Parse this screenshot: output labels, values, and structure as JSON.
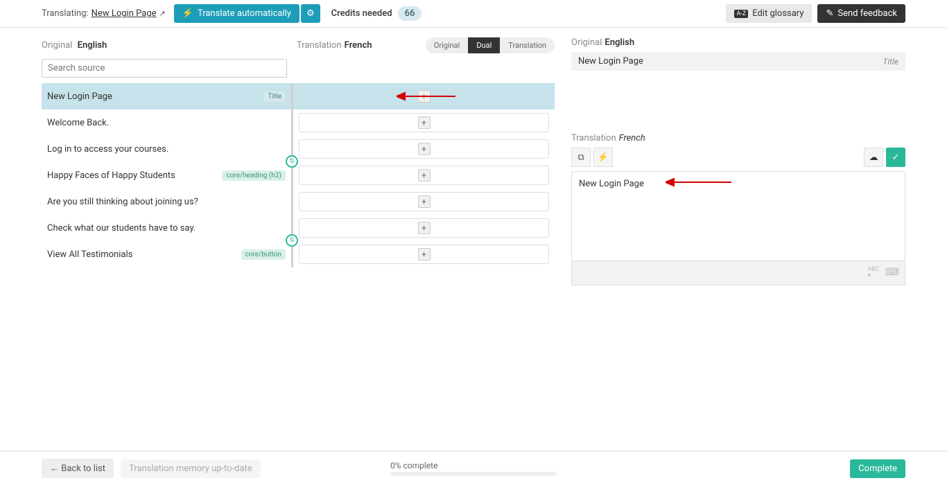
{
  "topbar": {
    "translating_label": "Translating:",
    "page_name": "New Login Page",
    "auto_btn": "Translate automatically",
    "credits_label": "Credits needed",
    "credits_value": "66",
    "glossary_btn": "Edit glossary",
    "feedback_btn": "Send feedback"
  },
  "columns": {
    "original_label": "Original",
    "original_lang": "English",
    "translation_label": "Translation",
    "translation_lang": "French",
    "search_placeholder": "Search source"
  },
  "view_tabs": {
    "original": "Original",
    "dual": "Dual",
    "translation": "Translation"
  },
  "rows": [
    {
      "text": "New Login Page",
      "tag": "Title",
      "tag_class": "tag-title",
      "selected": true
    },
    {
      "text": "Welcome Back."
    },
    {
      "text": "Log in to access your courses.",
      "link_after": true
    },
    {
      "text": "Happy Faces of Happy Students",
      "tag": "core/heading (h2)",
      "tag_class": "tag-core"
    },
    {
      "text": "Are you still thinking about joining us?"
    },
    {
      "text": "Check what our students have to say.",
      "link_after": true
    },
    {
      "text": "View All Testimonials",
      "tag": "core/button",
      "tag_class": "tag-core"
    }
  ],
  "detail": {
    "original_label": "Original",
    "original_lang": "English",
    "original_text": "New Login Page",
    "original_tag": "Title",
    "translation_label": "Translation",
    "translation_lang": "French",
    "editor_text": "New Login Page",
    "abc": "ABC"
  },
  "footer": {
    "back": "← Back to list",
    "memory": "Translation memory up-to-date",
    "progress": "0% complete",
    "complete": "Complete"
  }
}
